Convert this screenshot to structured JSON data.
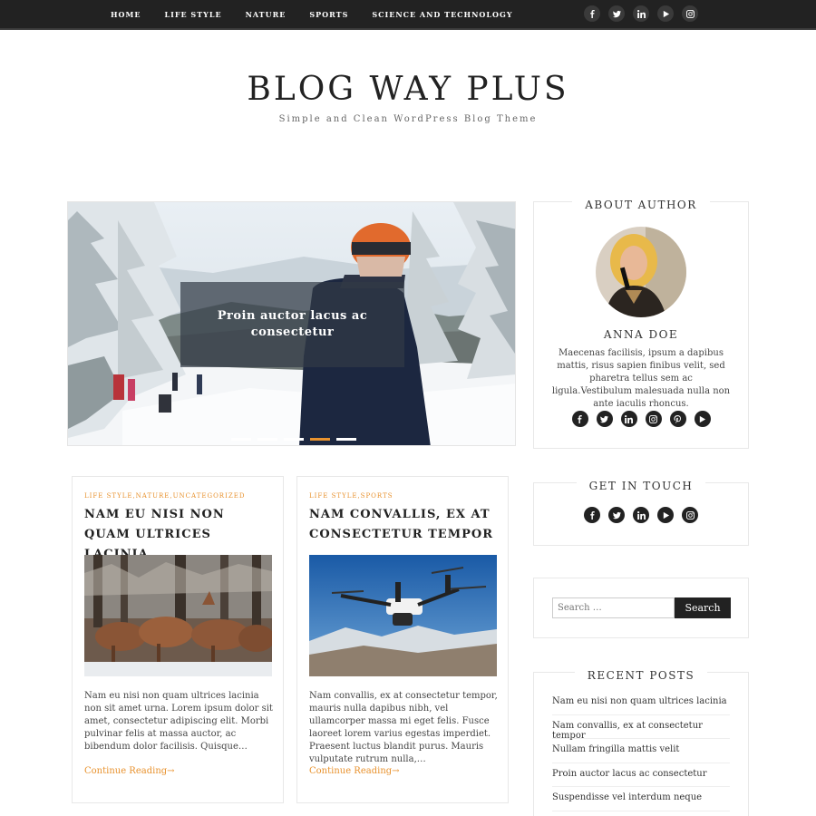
{
  "nav": {
    "items": [
      "HOME",
      "LIFE STYLE",
      "NATURE",
      "SPORTS",
      "SCIENCE AND TECHNOLOGY"
    ],
    "social_icons": [
      "facebook-icon",
      "twitter-icon",
      "linkedin-icon",
      "youtube-icon",
      "instagram-icon"
    ]
  },
  "header": {
    "title": "BLOG WAY PLUS",
    "tagline": "Simple and Clean WordPress Blog Theme"
  },
  "slider": {
    "caption": "Proin auctor lacus ac consectetur",
    "slide_count": 5,
    "active_index": 3
  },
  "posts": [
    {
      "categories": "LIFE STYLE,NATURE,UNCATEGORIZED",
      "title": "NAM EU NISI NON QUAM ULTRICES LACINIA",
      "excerpt": "Nam eu nisi non quam ultrices lacinia non sit amet urna. Lorem ipsum dolor sit amet, consectetur adipiscing elit. Morbi pulvinar felis at massa auctor, ac bibendum dolor facilisis. Quisque…",
      "more_label": "Continue Reading→"
    },
    {
      "categories": "LIFE STYLE,SPORTS",
      "title": "NAM CONVALLIS, EX AT CONSECTETUR TEMPOR",
      "excerpt": "Nam convallis, ex at consectetur tempor, mauris nulla dapibus nibh, vel ullamcorper massa mi eget felis. Fusce laoreet lorem varius egestas imperdiet. Praesent luctus blandit purus. Mauris vulputate rutrum nulla,…",
      "more_label": "Continue Reading→"
    }
  ],
  "sidebar": {
    "about": {
      "title": "ABOUT AUTHOR",
      "name": "ANNA DOE",
      "bio": "Maecenas facilisis, ipsum a dapibus mattis, risus sapien finibus velit, sed pharetra tellus sem ac ligula.Vestibulum malesuada nulla non ante iaculis rhoncus.",
      "social_icons": [
        "facebook-icon",
        "twitter-icon",
        "linkedin-icon",
        "instagram-icon",
        "pinterest-icon",
        "youtube-icon"
      ]
    },
    "touch": {
      "title": "GET IN TOUCH",
      "social_icons": [
        "facebook-icon",
        "twitter-icon",
        "linkedin-icon",
        "youtube-icon",
        "instagram-icon"
      ]
    },
    "search": {
      "placeholder": "Search …",
      "button_label": "Search"
    },
    "recent": {
      "title": "RECENT POSTS",
      "items": [
        "Nam eu nisi non quam ultrices lacinia",
        "Nam convallis, ex at consectetur tempor",
        "Nullam fringilla mattis velit",
        "Proin auctor lacus ac consectetur",
        "Suspendisse vel interdum neque"
      ]
    }
  },
  "colors": {
    "accent": "#e8922e",
    "dark": "#222222"
  }
}
